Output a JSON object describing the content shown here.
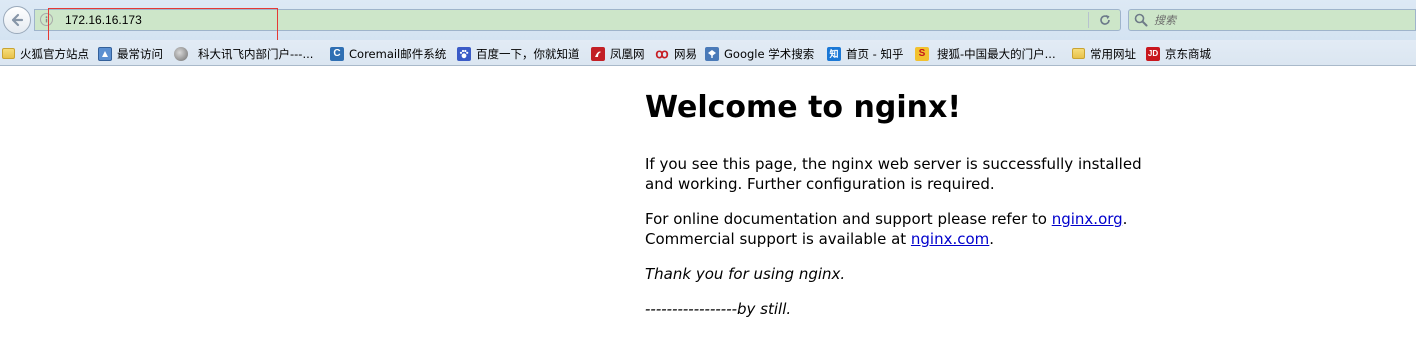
{
  "browser": {
    "url": "172.16.16.173",
    "search_placeholder": "搜索"
  },
  "bookmarks": [
    {
      "label": "火狐官方站点",
      "icon": "folder-icon"
    },
    {
      "label": "最常访问",
      "icon": "most-visited-icon"
    },
    {
      "label": "科大讯飞内部门户---...",
      "icon": "globe-icon"
    },
    {
      "label": "Coremail邮件系统",
      "icon": "coremail-icon",
      "glyph": "C"
    },
    {
      "label": "百度一下，你就知道",
      "icon": "baidu-paw-icon"
    },
    {
      "label": "凤凰网",
      "icon": "ifeng-icon"
    },
    {
      "label": "网易",
      "icon": "netease-icon",
      "glyph": "ꝏ"
    },
    {
      "label": "Google 学术搜索",
      "icon": "google-scholar-icon"
    },
    {
      "label": "首页 - 知乎",
      "icon": "zhihu-icon",
      "glyph": "知"
    },
    {
      "label": "搜狐-中国最大的门户...",
      "icon": "sohu-icon",
      "glyph": "S"
    },
    {
      "label": "常用网址",
      "icon": "folder-icon"
    },
    {
      "label": "京东商城",
      "icon": "jd-icon",
      "glyph": "JD"
    }
  ],
  "page": {
    "heading": "Welcome to nginx!",
    "para1": "If you see this page, the nginx web server is successfully installed and working. Further configuration is required.",
    "para2_prefix": "For online documentation and support please refer to ",
    "para2_link": "nginx.org",
    "para2_middle": ".\nCommercial support is available at ",
    "para2_link2": "nginx.com",
    "para2_suffix": ".",
    "thanks": "Thank you for using nginx.",
    "signature": "-----------------by still."
  },
  "colors": {
    "url_bar_bg": "#cde6c9",
    "highlight_box": "#e53935",
    "link": "#0000cc"
  }
}
